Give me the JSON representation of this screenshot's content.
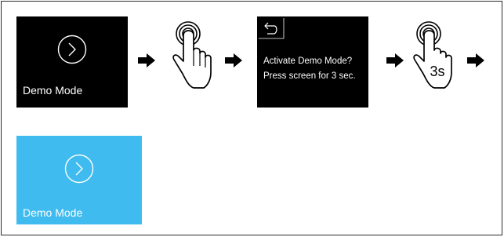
{
  "step1": {
    "label": "Demo Mode",
    "icon": "play-circle-icon"
  },
  "step2": {
    "gesture": "tap-finger-icon"
  },
  "step3": {
    "back_icon": "back-arrow-icon",
    "line1": "Activate Demo Mode?",
    "line2": "Press screen for 3 sec."
  },
  "step4": {
    "gesture": "press-hold-finger-icon",
    "duration_label": "3s"
  },
  "result": {
    "label": "Demo Mode",
    "icon": "play-circle-icon"
  },
  "colors": {
    "screen_dark": "#000000",
    "screen_active": "#3fbbef",
    "arrow": "#000000"
  }
}
